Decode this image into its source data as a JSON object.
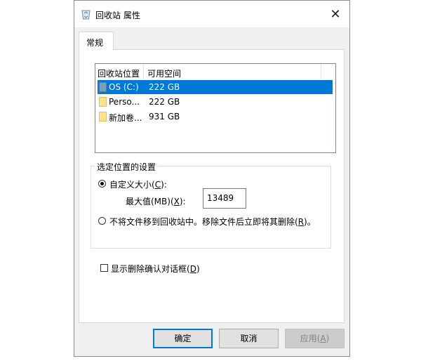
{
  "window": {
    "title": "回收站 属性",
    "close_glyph": "✕"
  },
  "tab": {
    "label": "常规"
  },
  "list": {
    "headers": [
      "回收站位置",
      "可用空间"
    ],
    "rows": [
      {
        "name": "OS (C:)",
        "space": "222 GB",
        "icon": "drive-icon",
        "selected": true
      },
      {
        "name": "Perso...",
        "space": "222 GB",
        "icon": "folder-icon",
        "selected": false
      },
      {
        "name": "新加卷...",
        "space": "931 GB",
        "icon": "folder-icon",
        "selected": false
      }
    ]
  },
  "settings": {
    "group_label": "选定位置的设置",
    "custom_size": {
      "text": "自定义大小(",
      "mnemonic": "C",
      "suffix": "):",
      "checked": true
    },
    "max_size": {
      "text": "最大值(MB)(",
      "mnemonic": "X",
      "suffix": "):",
      "value": "13489"
    },
    "no_move": {
      "text": "不将文件移到回收站中。移除文件后立即将其删除(",
      "mnemonic": "R",
      "suffix": ")。",
      "checked": false
    }
  },
  "confirm_delete": {
    "text": "显示删除确认对话框(",
    "mnemonic": "D",
    "suffix": ")",
    "checked": false
  },
  "buttons": {
    "ok": "确定",
    "cancel": "取消",
    "apply": {
      "text": "应用(",
      "mnemonic": "A",
      "suffix": ")"
    }
  },
  "colors": {
    "selection": "#0078d7",
    "dialog_bg": "#f0f0f0"
  }
}
